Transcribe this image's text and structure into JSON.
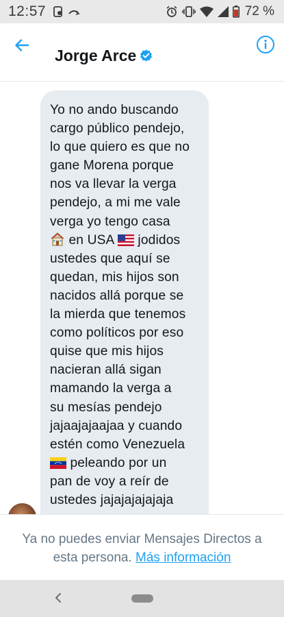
{
  "status_bar": {
    "time": "12:57",
    "battery": "72 %",
    "icons": [
      "notification-icon",
      "missed-call-icon",
      "alarm-icon",
      "vibrate-icon",
      "wifi-icon",
      "signal-icon",
      "battery-icon"
    ]
  },
  "header": {
    "title": "Jorge Arce",
    "back_icon": "arrow-left-icon",
    "verified_icon": "verified-badge-icon",
    "info_icon": "info-icon"
  },
  "message": {
    "lines": [
      "Yo no ando buscando",
      "cargo público pendejo,",
      "lo que quiero es que no",
      "gane Morena porque",
      "nos va llevar la verga",
      "pendejo, a mi me vale",
      "verga yo tengo casa",
      "en USA",
      "jodidos",
      "ustedes que aquí se",
      "quedan, mis hijos son",
      "nacidos allá porque se",
      "la mierda que tenemos",
      "como políticos por eso",
      "quise que mis hijos",
      "nacieran allá sigan",
      "mamando la verga a",
      "su mesías pendejo",
      "jajaajajaajaa y cuando",
      "estén como Venezuela",
      "peleando por un",
      "pan de voy a reír de",
      "ustedes jajajajajajaja"
    ],
    "emoji_house": "house-emoji",
    "emoji_us_flag": "us-flag-emoji",
    "emoji_ve_flag": "venezuela-flag-emoji"
  },
  "footer": {
    "notice_line1": "Ya no puedes enviar Mensajes Directos a",
    "notice_line2": "esta persona.",
    "link": "Más información"
  },
  "colors": {
    "accent": "#1da1f2",
    "bubble": "#e6ecf0",
    "muted_text": "#657786"
  }
}
